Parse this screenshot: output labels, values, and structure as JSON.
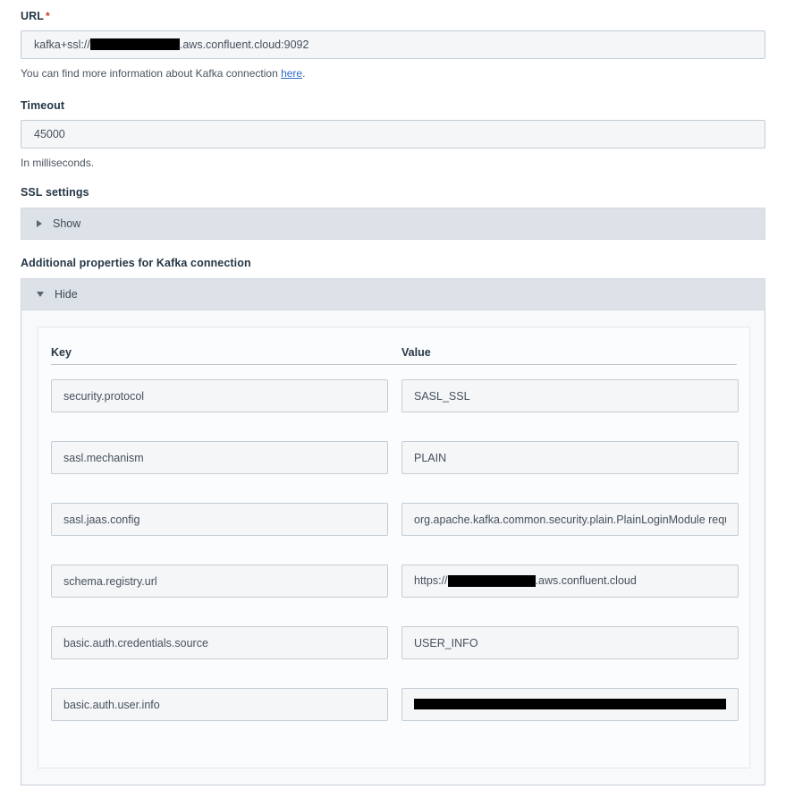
{
  "url_field": {
    "label": "URL",
    "required_marker": "*",
    "value_prefix": "kafka+ssl://",
    "value_redacted": true,
    "value_suffix": ".aws.confluent.cloud:9092",
    "help_prefix": "You can find more information about Kafka connection ",
    "help_link": "here",
    "help_suffix": "."
  },
  "timeout_field": {
    "label": "Timeout",
    "value": "45000",
    "help": "In milliseconds."
  },
  "ssl_settings": {
    "label": "SSL settings",
    "toggle_label": "Show",
    "toggle_state": "collapsed",
    "icon": "triangle-right-icon"
  },
  "additional_properties": {
    "label": "Additional properties for Kafka connection",
    "toggle_label": "Hide",
    "toggle_state": "expanded",
    "icon": "triangle-down-icon",
    "table": {
      "columns": [
        "Key",
        "Value"
      ],
      "rows": [
        {
          "key": "security.protocol",
          "value": "SASL_SSL",
          "value_redacted": false
        },
        {
          "key": "sasl.mechanism",
          "value": "PLAIN",
          "value_redacted": false
        },
        {
          "key": "sasl.jaas.config",
          "value": "org.apache.kafka.common.security.plain.PlainLoginModule required userna",
          "value_redacted": false,
          "value_truncated": true
        },
        {
          "key": "schema.registry.url",
          "value_prefix": "https://",
          "value_redacted": "partial",
          "value_suffix": ".aws.confluent.cloud"
        },
        {
          "key": "basic.auth.credentials.source",
          "value": "USER_INFO",
          "value_redacted": false
        },
        {
          "key": "basic.auth.user.info",
          "value": "",
          "value_redacted": "full"
        }
      ]
    }
  },
  "colors": {
    "input_bg": "#f4f6f8",
    "input_border": "#c3cdd7",
    "label_text": "#253746",
    "help_text": "#4a5560",
    "link": "#2d6cca",
    "required_star": "#d0342c",
    "disclosure_bg": "#dde2e8",
    "panel_bg": "#f7f9fb",
    "redaction": "#000000"
  }
}
